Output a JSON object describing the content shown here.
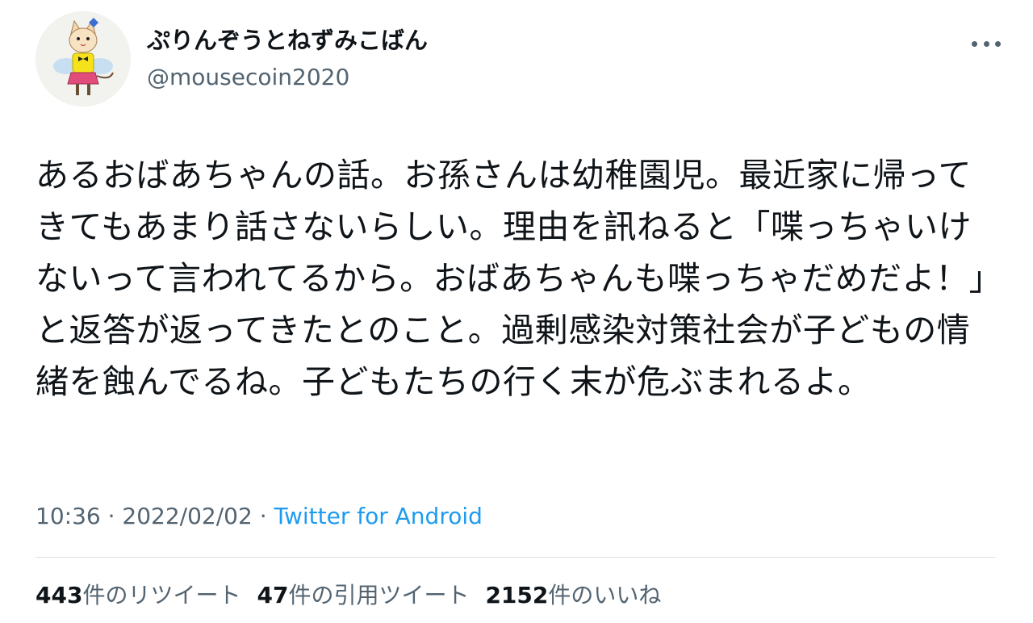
{
  "user": {
    "display_name": "ぷりんぞうとねずみこばん",
    "handle": "@mousecoin2020"
  },
  "tweet": {
    "text": "あるおばあちゃんの話。お孫さんは幼稚園児。最近家に帰ってきてもあまり話さないらしい。理由を訊ねると「喋っちゃいけないって言われてるから。おばあちゃんも喋っちゃだめだよ！」と返答が返ってきたとのこと。過剰感染対策社会が子どもの情緒を蝕んでるね。子どもたちの行く末が危ぶまれるよ。",
    "time": "10:36",
    "separator": " · ",
    "date": "2022/02/02",
    "source": "Twitter for Android"
  },
  "stats": {
    "retweets_count": "443",
    "retweets_label": "件のリツイート",
    "quotes_count": "47",
    "quotes_label": "件の引用ツイート",
    "likes_count": "2152",
    "likes_label": "件のいいね"
  },
  "icons": {
    "more": "more-horizontal-icon",
    "avatar": "cat-drawing-avatar"
  },
  "colors": {
    "text_primary": "#0f1419",
    "text_secondary": "#536471",
    "link": "#1d9bf0",
    "divider": "#dde1e4"
  }
}
